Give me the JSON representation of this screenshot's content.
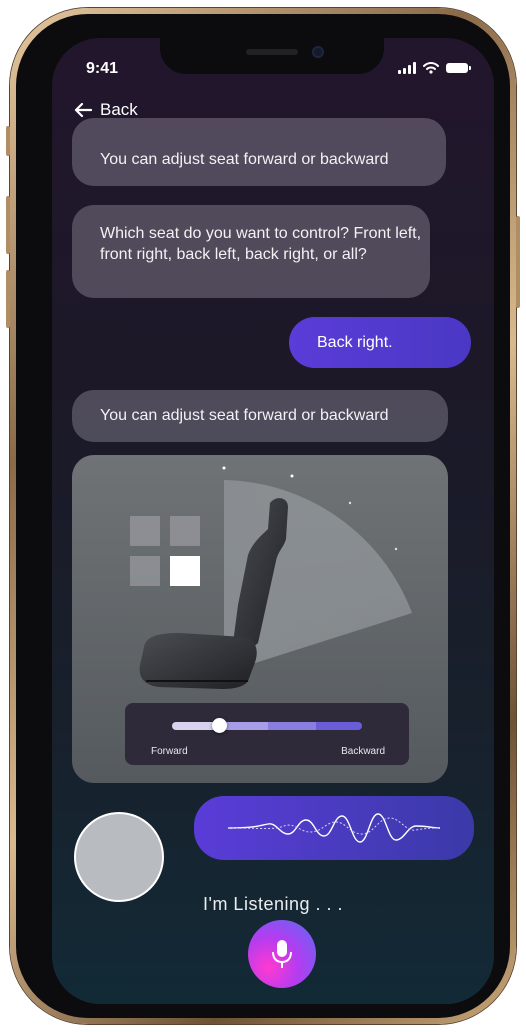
{
  "status_bar": {
    "time": "9:41"
  },
  "nav": {
    "back_label": "Back"
  },
  "chat": {
    "previous_message": "You can adjust seat forward or backward",
    "question_message": "Which seat do you want to control? Front left, front right, back left, back right, or all?",
    "user_reply": "Back right.",
    "adjust_message": "You can adjust seat forward or backward"
  },
  "seat_control": {
    "selected_seat": "back-right",
    "slider": {
      "label_left": "Forward",
      "label_right": "Backward",
      "position_fraction": 0.25
    }
  },
  "voice": {
    "listening_text": "I'm Listening . . ."
  },
  "colors": {
    "accent": "#5a3cd8",
    "mic_gradient_start": "#ff3ad0",
    "mic_gradient_end": "#5a6cf4"
  },
  "icons": {
    "back": "arrow-left-icon",
    "mic": "microphone-icon",
    "wifi": "wifi-icon",
    "signal": "signal-icon",
    "battery": "battery-icon"
  }
}
